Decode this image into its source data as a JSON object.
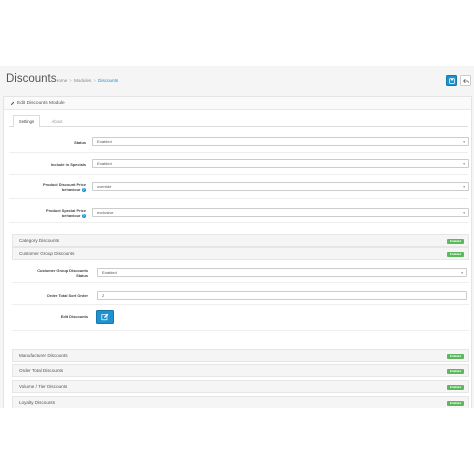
{
  "header": {
    "title": "Discounts",
    "breadcrumb": [
      "Home",
      "Modules",
      "Discounts"
    ]
  },
  "panel": {
    "heading": "Edit Discounts Module",
    "tabs": [
      {
        "label": "Settings",
        "active": true
      },
      {
        "label": "About",
        "active": false
      }
    ]
  },
  "fields": {
    "status": {
      "label": "Status",
      "value": "Enabled"
    },
    "specials": {
      "label": "Include in Specials",
      "value": "Enabled"
    },
    "product_discount": {
      "label_line1": "Product Discount Price",
      "label_line2": "behaviour",
      "value": "override"
    },
    "product_special": {
      "label_line1": "Product Special Price",
      "label_line2": "behaviour",
      "value": "exclusive"
    }
  },
  "sections": {
    "category": {
      "label": "Category Discounts",
      "badge": "Enabled"
    },
    "customer_group": {
      "label": "Customer Group Discounts",
      "badge": "Enabled"
    },
    "manufacturer": {
      "label": "Manufacturer Discounts",
      "badge": "Enabled"
    },
    "order_total": {
      "label": "Order Total Discounts",
      "badge": "Enabled"
    },
    "volume": {
      "label": "Volume / Tier Discounts",
      "badge": "Enabled"
    },
    "loyalty": {
      "label": "Loyalty Discounts",
      "badge": "Enabled"
    }
  },
  "customer_group": {
    "status": {
      "label_line1": "Customer Group Discounts",
      "label_line2": "Status",
      "value": "Enabled"
    },
    "sort_order": {
      "label": "Order Total Sort Order",
      "value": "2"
    },
    "edit": {
      "label": "Edit Discounts"
    }
  },
  "colors": {
    "primary": "#1e91cf",
    "success": "#5cb85c"
  }
}
